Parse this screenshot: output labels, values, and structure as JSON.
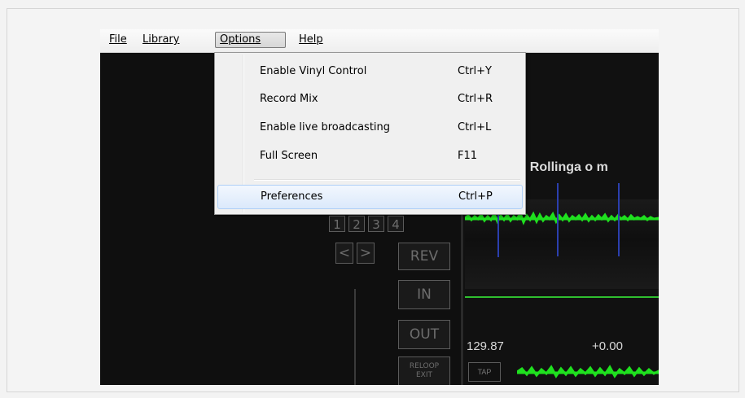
{
  "menubar": {
    "items": [
      {
        "label": "File"
      },
      {
        "label": "Library"
      },
      {
        "label": "Options"
      },
      {
        "label": "Help"
      }
    ]
  },
  "options_menu": {
    "items": [
      {
        "label": "Enable Vinyl Control",
        "shortcut": "Ctrl+Y"
      },
      {
        "label": "Record Mix",
        "shortcut": "Ctrl+R"
      },
      {
        "label": "Enable live broadcasting",
        "shortcut": "Ctrl+L"
      },
      {
        "label": "Full Screen",
        "shortcut": "F11"
      },
      {
        "label": "Preferences",
        "shortcut": "Ctrl+P"
      }
    ]
  },
  "deck": {
    "track_title": "ez, Rollinga o m",
    "hotcues": [
      "1",
      "2",
      "3",
      "4"
    ],
    "nav_prev": "<",
    "nav_next": ">",
    "rev_label": "REV",
    "in_label": "IN",
    "out_label": "OUT",
    "reloop_label": "RELOOP",
    "exit_label": "EXIT",
    "bpm": "129.87",
    "pitch": "+0.00",
    "tap_label": "TAP"
  },
  "colors": {
    "waveform": "#1fe01f",
    "beat_marker": "#2b3fae",
    "menu_highlight": "#dbe9fb"
  }
}
